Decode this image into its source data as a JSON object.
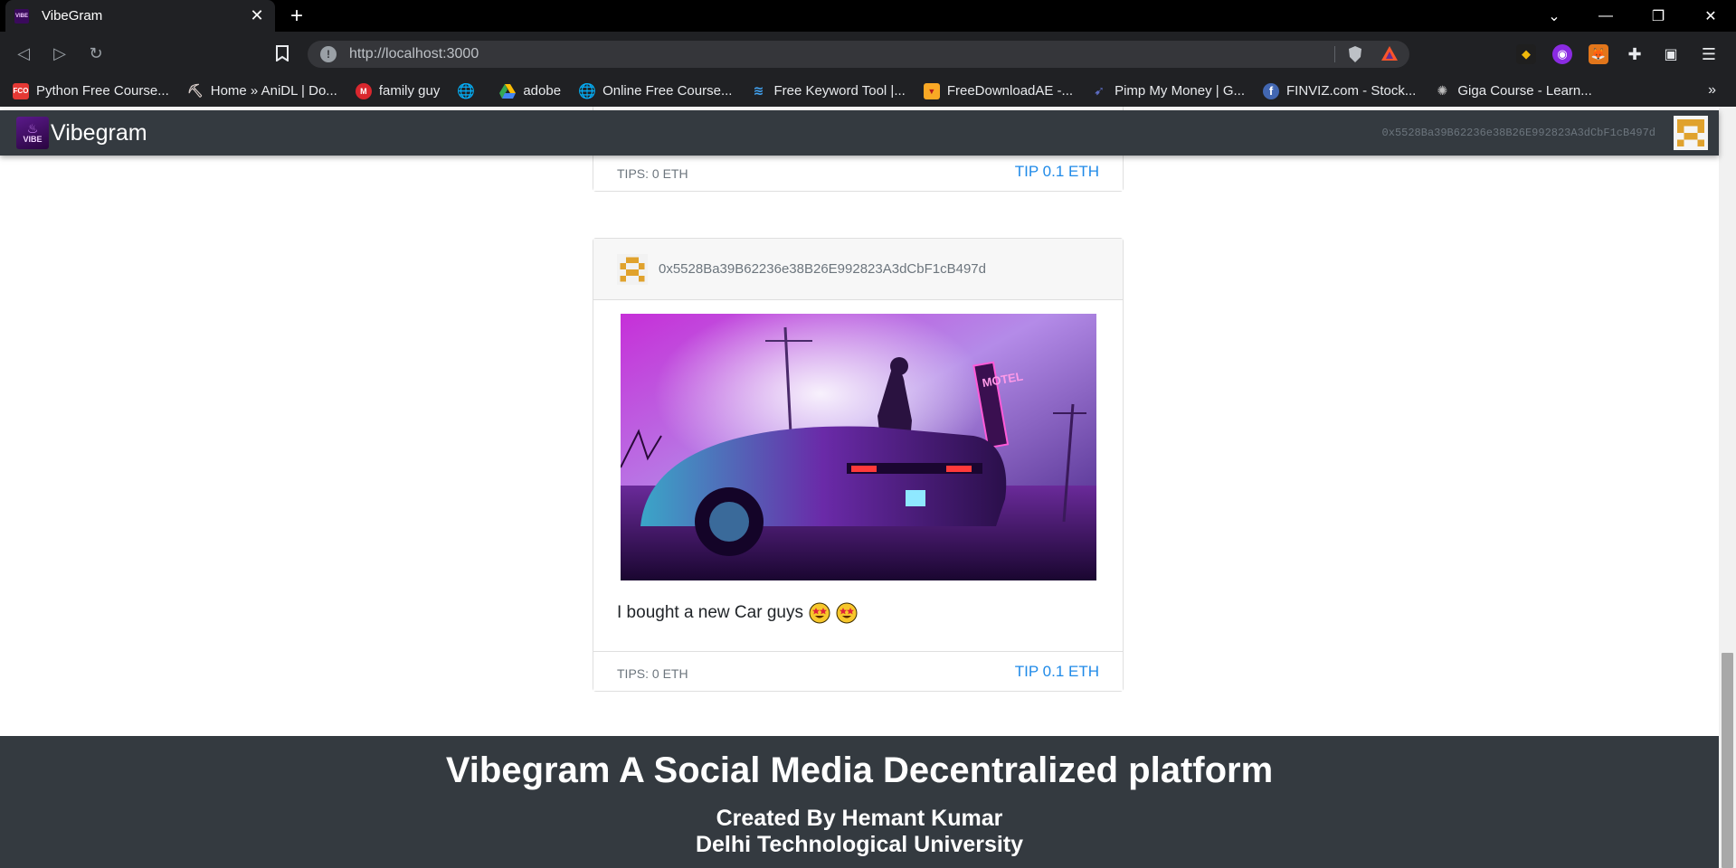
{
  "browser": {
    "tab_title": "VibeGram",
    "tab_favicon_text": "VIBE",
    "new_tab_glyph": "+",
    "url": "http://localhost:3000",
    "bookmarks": [
      {
        "label": "Python Free Course...",
        "icon": "fco-icon",
        "icon_text": "FCO",
        "color": "#e53935"
      },
      {
        "label": "Home » AniDL | Do...",
        "icon": "anidl-icon",
        "icon_text": "",
        "color": "#7d5a50"
      },
      {
        "label": "family guy",
        "icon": "mega-icon",
        "icon_text": "M",
        "color": "#d9272e"
      },
      {
        "label": "",
        "icon": "globe-icon",
        "icon_text": "",
        "color": "#9aa0a6"
      },
      {
        "label": "adobe",
        "icon": "google-drive-icon",
        "icon_text": "",
        "color": "#34a853"
      },
      {
        "label": "Online Free Course...",
        "icon": "globe-icon",
        "icon_text": "",
        "color": "#9aa0a6"
      },
      {
        "label": "Free Keyword Tool |...",
        "icon": "keyword-tool-icon",
        "icon_text": "",
        "color": "#1e88e5"
      },
      {
        "label": "FreeDownloadAE -...",
        "icon": "freedownload-icon",
        "icon_text": "",
        "color": "#f9a825"
      },
      {
        "label": "Pimp My Money | G...",
        "icon": "pmm-icon",
        "icon_text": "",
        "color": "#3949ab"
      },
      {
        "label": "FINVIZ.com - Stock...",
        "icon": "finviz-icon",
        "icon_text": "f",
        "color": "#4267b2"
      },
      {
        "label": "Giga Course - Learn...",
        "icon": "giga-icon",
        "icon_text": "",
        "color": "#757575"
      }
    ]
  },
  "app": {
    "brand_name": "Vibegram",
    "brand_logo_text": "VIBE",
    "account_address": "0x5528Ba39B62236e38B26E992823A3dCbF1cB497d",
    "posts": [
      {
        "tips": "TIPS: 0 ETH",
        "tip_button": "TIP 0.1 ETH"
      },
      {
        "author": "0x5528Ba39B62236e38B26E992823A3dCbF1cB497d",
        "image_sign": "MOTEL",
        "caption": "I bought a new Car guys",
        "tips": "TIPS: 0 ETH",
        "tip_button": "TIP 0.1 ETH"
      }
    ],
    "footer": {
      "title": "Vibegram A Social Media Decentralized platform",
      "author": "Created By Hemant Kumar",
      "university": "Delhi Technological University"
    }
  },
  "colors": {
    "navbar": "#343a40",
    "link": "#1f8ae8",
    "identicon": "#e0a22d"
  }
}
